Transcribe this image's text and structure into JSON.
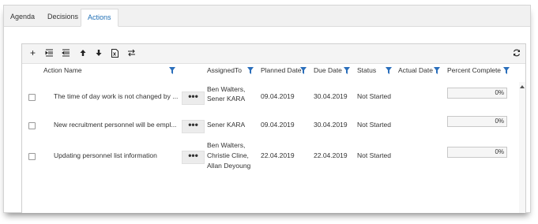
{
  "tabs": [
    {
      "label": "Agenda"
    },
    {
      "label": "Decisions"
    },
    {
      "label": "Actions"
    }
  ],
  "toolbar": {
    "buttons": [
      "add",
      "indent",
      "outdent",
      "move-up",
      "move-down",
      "export-excel",
      "swap"
    ],
    "add_label": "+"
  },
  "columns": {
    "action_name": "Action Name",
    "assigned_to": "AssignedTo",
    "planned_date": "Planned Date",
    "due_date": "Due Date",
    "status": "Status",
    "actual_date": "Actual Date",
    "percent_complete": "Percent Complete"
  },
  "rows": [
    {
      "name": "The time of day work is not changed by ...",
      "assigned": [
        "Ben Walters,",
        "Sener KARA"
      ],
      "planned": "09.04.2019",
      "due": "30.04.2019",
      "status": "Not Started",
      "actual": "",
      "percent": "0%"
    },
    {
      "name": "New recruitment personnel will be empl...",
      "assigned": [
        "Sener KARA"
      ],
      "planned": "09.04.2019",
      "due": "30.04.2019",
      "status": "Not Started",
      "actual": "",
      "percent": "0%"
    },
    {
      "name": "Updating personnel list information",
      "assigned": [
        "Ben Walters,",
        "Christie Cline,",
        "Allan Deyoung"
      ],
      "planned": "22.04.2019",
      "due": "22.04.2019",
      "status": "Not Started",
      "actual": "",
      "percent": "0%"
    }
  ],
  "more_label": "•••",
  "colors": {
    "accent": "#1f6fb5",
    "filter_icon": "#2a6ebb"
  }
}
